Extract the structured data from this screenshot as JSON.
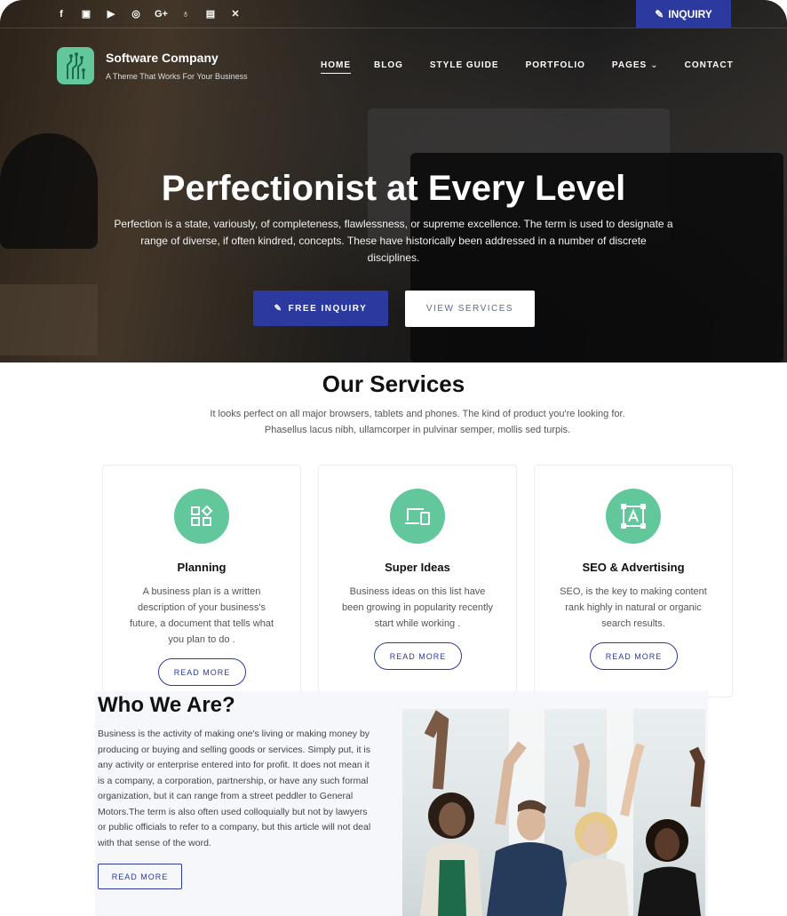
{
  "topbar": {
    "social_icons": [
      "facebook-icon",
      "twitter-icon",
      "youtube-icon",
      "instagram-icon",
      "google-plus-icon",
      "odnoklassniki-icon",
      "vk-icon",
      "xing-icon"
    ],
    "inquiry_label": "INQUIRY"
  },
  "brand": {
    "name": "Software Company",
    "tagline": "A Theme That Works For Your Business"
  },
  "nav": {
    "items": [
      "HOME",
      "BLOG",
      "STYLE GUIDE",
      "PORTFOLIO",
      "PAGES",
      "CONTACT"
    ]
  },
  "hero": {
    "title": "Perfectionist at Every Level",
    "text": "Perfection is a state, variously, of completeness, flawlessness, or supreme excellence. The term is used to designate a range of diverse, if often kindred, concepts. These have historically been addressed in a number of discrete disciplines.",
    "primary_button": "FREE INQUIRY",
    "secondary_button": "VIEW SERVICES"
  },
  "services": {
    "title": "Our Services",
    "text": "It looks perfect on all major browsers, tablets and phones. The kind of product you're looking for. Phasellus lacus nibh, ullamcorper in pulvinar semper, mollis sed turpis.",
    "cards": [
      {
        "title": "Planning",
        "text": "A business plan is a written description of your business's future, a document that tells what you plan to do .",
        "button": "READ MORE",
        "icon": "grid-icon"
      },
      {
        "title": "Super Ideas",
        "text": "Business ideas on this list have been growing in popularity recently start while working .",
        "button": "READ MORE",
        "icon": "devices-icon"
      },
      {
        "title": "SEO & Advertising",
        "text": "SEO, is the key to making content rank highly in natural or organic search results.",
        "button": "READ MORE",
        "icon": "font-frame-icon"
      }
    ]
  },
  "who": {
    "title": "Who We Are?",
    "text": "Business is the activity of making one's living or making money by producing or buying and selling goods or services. Simply put, it is any activity or enterprise entered into for profit. It does not mean it is a company, a corporation, partnership, or have any such formal organization, but it can range from a street peddler to General Motors.The term is also often used colloquially but not by lawyers or public officials to refer to a company, but this article will not deal with that sense of the word.",
    "button": "READ MORE"
  },
  "colors": {
    "primary": "#2c3aa0",
    "accent": "#62c79a"
  }
}
